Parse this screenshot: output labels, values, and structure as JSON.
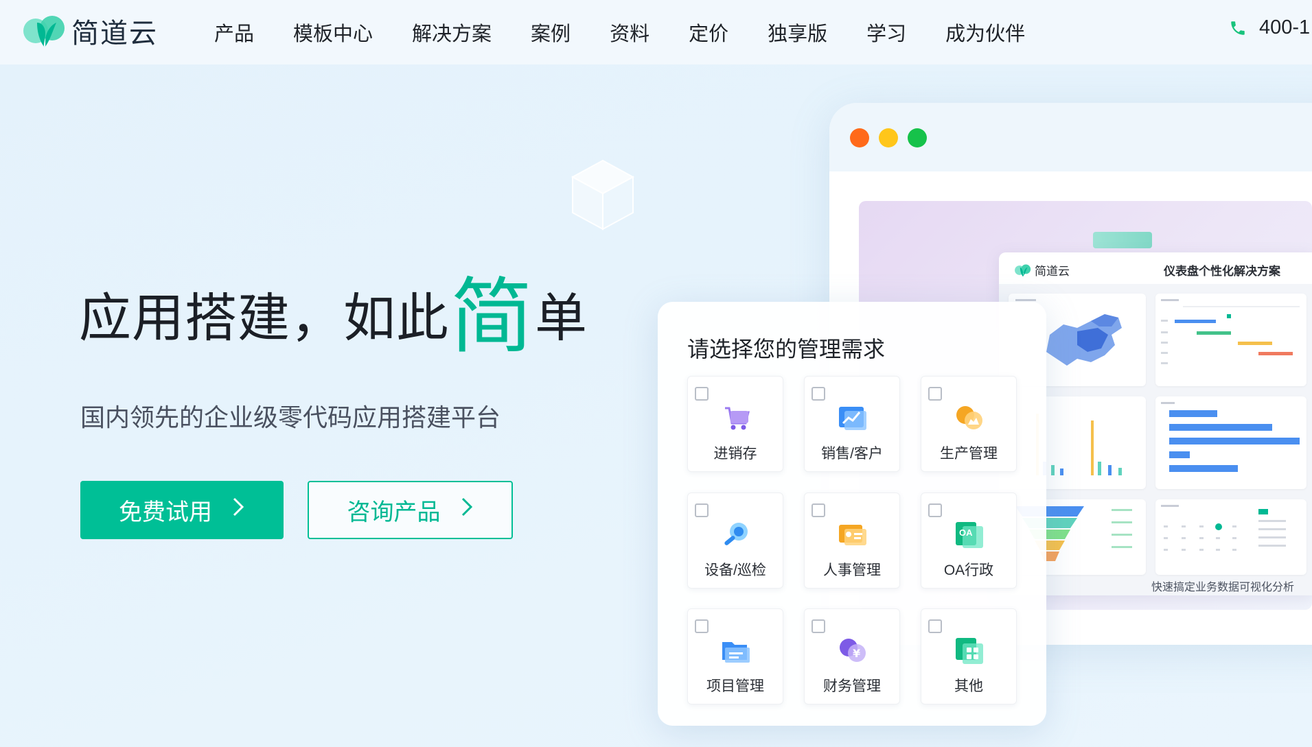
{
  "brand": {
    "name": "简道云",
    "color": "#00bf96"
  },
  "nav": {
    "items": [
      "产品",
      "模板中心",
      "解决方案",
      "案例",
      "资料",
      "定价",
      "独享版",
      "学习",
      "成为伙伴"
    ],
    "phone": "400-1"
  },
  "hero": {
    "title_prefix": "应用搭建，如此",
    "title_accent": "简",
    "title_suffix": "单",
    "subtitle": "国内领先的企业级零代码应用搭建平台",
    "primary_button": "免费试用",
    "secondary_button": "咨询产品"
  },
  "browser": {
    "dot_colors": [
      "#ff6a1a",
      "#ffc61a",
      "#16c24a"
    ],
    "dashboard": {
      "logo_text": "简道云",
      "title": "仪表盘个性化解决方案",
      "caption": "快速搞定业务数据可视化分析"
    }
  },
  "selector": {
    "title": "请选择您的管理需求",
    "options": [
      {
        "label": "进销存",
        "icon": "shopping-cart-icon"
      },
      {
        "label": "销售/客户",
        "icon": "trend-chart-icon"
      },
      {
        "label": "生产管理",
        "icon": "factory-icon"
      },
      {
        "label": "设备/巡检",
        "icon": "wrench-icon"
      },
      {
        "label": "人事管理",
        "icon": "id-card-icon"
      },
      {
        "label": "OA行政",
        "icon": "oa-document-icon",
        "icon_text": "OA"
      },
      {
        "label": "项目管理",
        "icon": "folder-icon"
      },
      {
        "label": "财务管理",
        "icon": "yuan-coin-icon",
        "icon_text": "¥"
      },
      {
        "label": "其他",
        "icon": "grid-apps-icon"
      }
    ]
  }
}
